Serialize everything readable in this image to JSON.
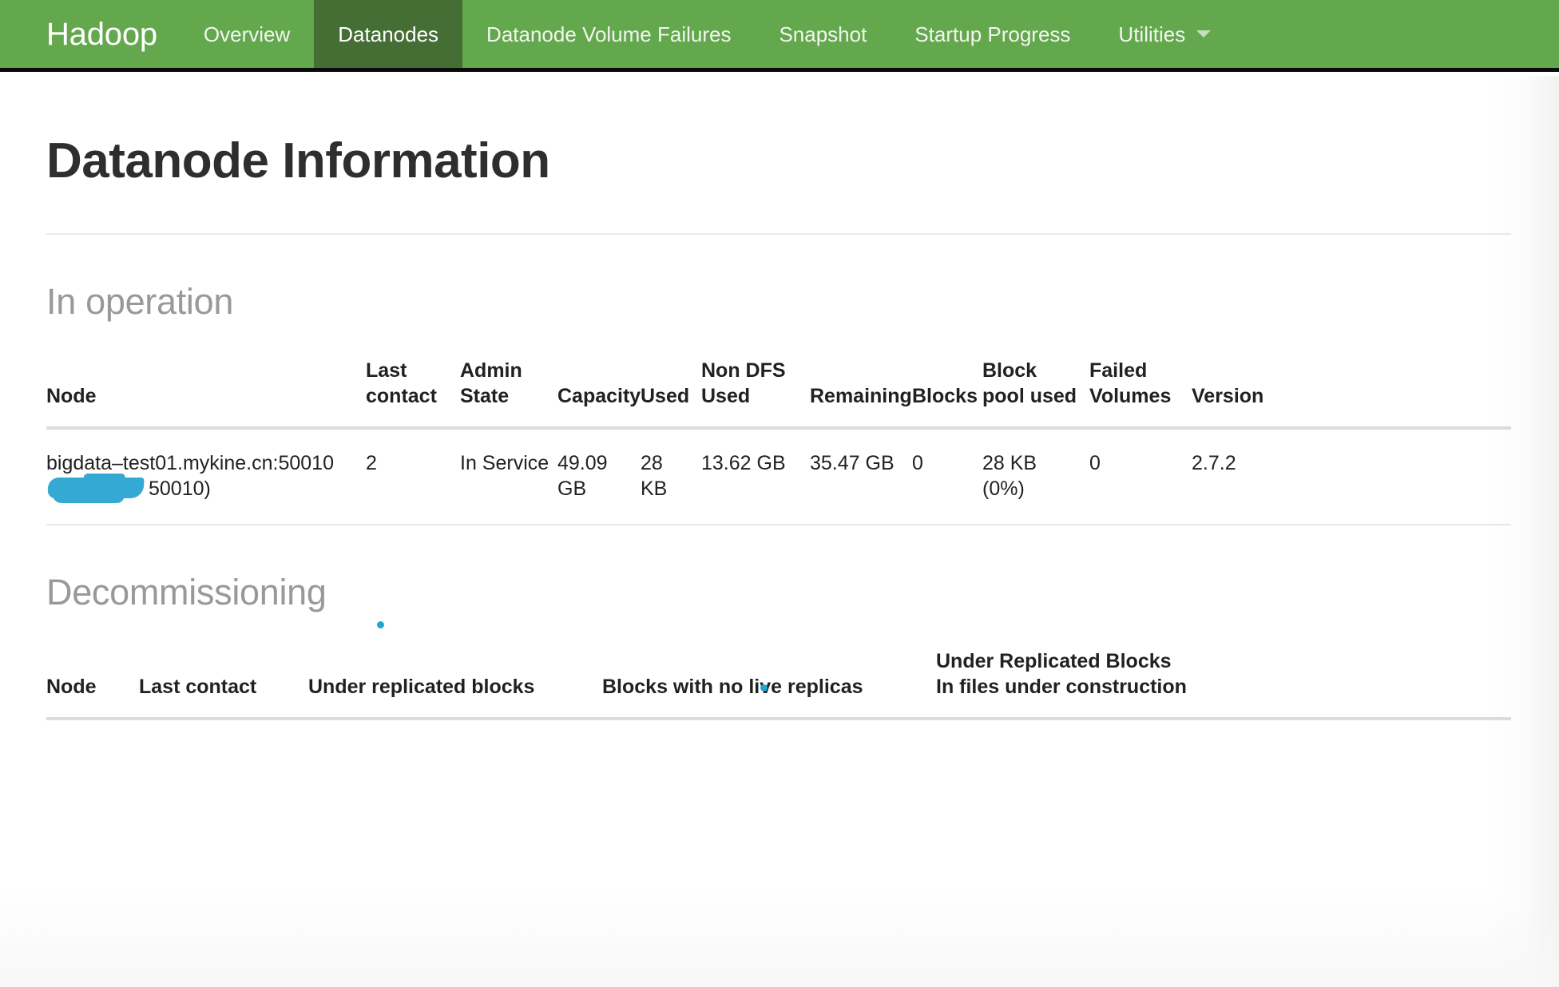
{
  "navbar": {
    "brand": "Hadoop",
    "items": [
      {
        "label": "Overview",
        "active": false,
        "caret": false
      },
      {
        "label": "Datanodes",
        "active": true,
        "caret": false
      },
      {
        "label": "Datanode Volume Failures",
        "active": false,
        "caret": false
      },
      {
        "label": "Snapshot",
        "active": false,
        "caret": false
      },
      {
        "label": "Startup Progress",
        "active": false,
        "caret": false
      },
      {
        "label": "Utilities",
        "active": false,
        "caret": true
      }
    ],
    "background_color": "#63a84d",
    "active_background_color": "#456e35"
  },
  "page": {
    "title": "Datanode Information"
  },
  "in_operation": {
    "title": "In operation",
    "columns": [
      "Node",
      "Last contact",
      "Admin State",
      "Capacity",
      "Used",
      "Non DFS Used",
      "Remaining",
      "Blocks",
      "Block pool used",
      "Failed Volumes",
      "Version"
    ],
    "rows": [
      {
        "node_line1": "bigdata–test01.mykine.cn:50010",
        "node_line2_redacted": true,
        "node_line2_tail": "50010)",
        "last_contact": "2",
        "admin_state": "In Service",
        "capacity": "49.09 GB",
        "used": "28 KB",
        "non_dfs_used": "13.62 GB",
        "remaining": "35.47 GB",
        "blocks": "0",
        "block_pool_used": "28 KB (0%)",
        "failed_volumes": "0",
        "version": "2.7.2"
      }
    ]
  },
  "decommissioning": {
    "title": "Decommissioning",
    "columns": [
      "Node",
      "Last contact",
      "Under replicated blocks",
      "Blocks with no live replicas",
      "Under Replicated Blocks In files under construction"
    ],
    "columns_multiline": [
      [
        "Node"
      ],
      [
        "Last contact"
      ],
      [
        "Under replicated blocks"
      ],
      [
        "Blocks with no live replicas"
      ],
      [
        "Under Replicated Blocks",
        "In files under construction"
      ]
    ],
    "rows": []
  },
  "annotations": {
    "redaction_color": "#33a9d4",
    "dot_color": "#22a5d0"
  }
}
